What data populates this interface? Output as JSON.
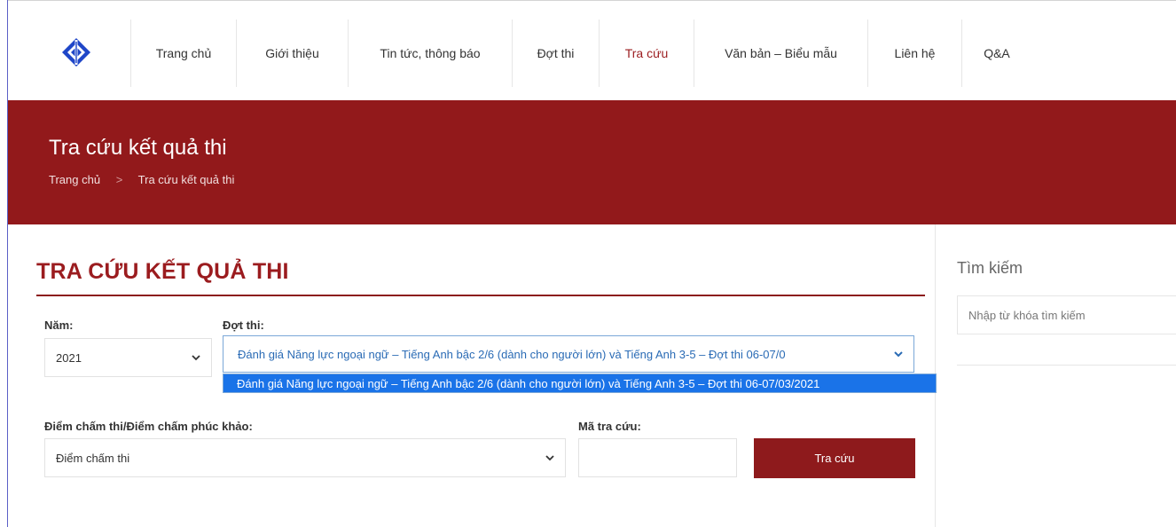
{
  "colors": {
    "brand_red": "#92191b",
    "heading_red": "#9b1c1f",
    "button_red": "#8e1a1c",
    "logo_blue": "#1f46c8",
    "highlight_blue": "#1a73e8"
  },
  "nav": {
    "logo_icon": "diamond-logo-icon",
    "items": [
      {
        "label": "Trang chủ"
      },
      {
        "label": "Giới thiệu"
      },
      {
        "label": "Tin tức, thông báo"
      },
      {
        "label": "Đợt thi"
      },
      {
        "label": "Tra cứu",
        "active": true
      },
      {
        "label": "Văn bản – Biểu mẫu"
      },
      {
        "label": "Liên hệ"
      },
      {
        "label": "Q&A"
      }
    ]
  },
  "banner": {
    "title": "Tra cứu kết quả thi",
    "breadcrumb": {
      "home": "Trang chủ",
      "separator": ">",
      "current": "Tra cứu kết quả thi"
    }
  },
  "form": {
    "heading": "TRA CỨU KẾT QUẢ THI",
    "year": {
      "label": "Năm:",
      "value": "2021"
    },
    "exam_round": {
      "label": "Đợt thi:",
      "value": "Đánh giá Năng lực ngoại ngữ – Tiếng Anh bậc 2/6 (dành cho người lớn) và Tiếng Anh 3-5 – Đợt thi 06-07/0",
      "options": [
        "Đánh giá Năng lực ngoại ngữ – Tiếng Anh bậc 2/6 (dành cho người lớn) và Tiếng Anh 3-5 – Đợt thi 06-07/03/2021"
      ]
    },
    "score_type": {
      "label": "Điểm chấm thi/Điểm chấm phúc khảo:",
      "value": "Điểm chấm thi"
    },
    "lookup_code": {
      "label": "Mã tra cứu:",
      "value": ""
    },
    "submit_label": "Tra cứu"
  },
  "sidebar": {
    "title": "Tìm kiếm",
    "search_placeholder": "Nhập từ khóa tìm kiếm"
  }
}
